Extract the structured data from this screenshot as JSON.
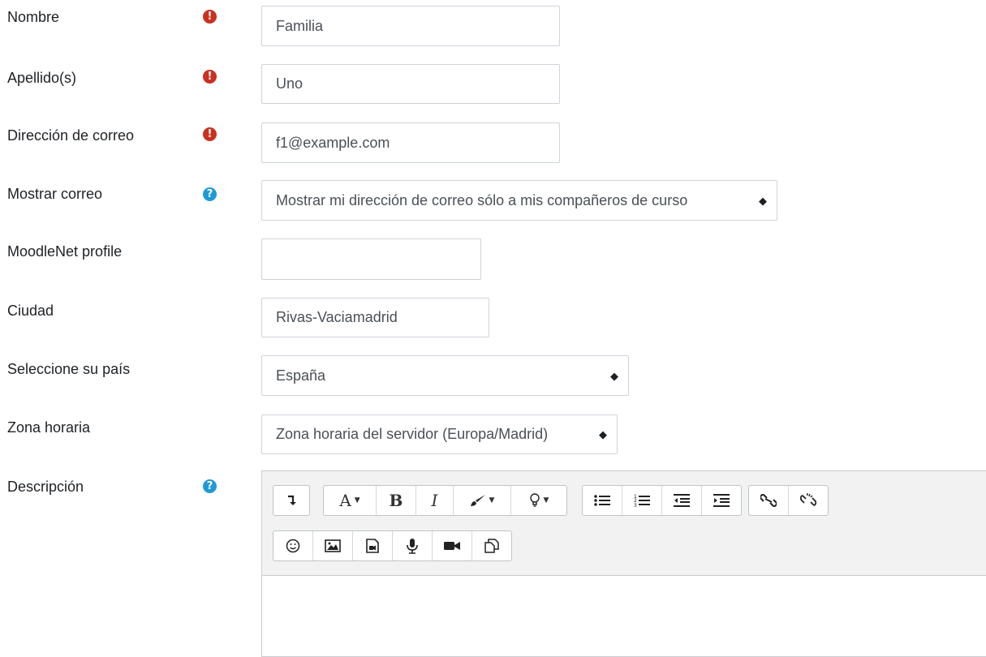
{
  "form": {
    "fields": [
      {
        "label": "Nombre",
        "indicator": "required",
        "value": "Familia"
      },
      {
        "label": "Apellido(s)",
        "indicator": "required",
        "value": "Uno"
      },
      {
        "label": "Dirección de correo",
        "indicator": "required",
        "value": "f1@example.com"
      },
      {
        "label": "Mostrar correo",
        "indicator": "help",
        "value": "Mostrar mi dirección de correo sólo a mis compañeros de curso"
      },
      {
        "label": "MoodleNet profile",
        "indicator": "none",
        "value": ""
      },
      {
        "label": "Ciudad",
        "indicator": "none",
        "value": "Rivas-Vaciamadrid"
      },
      {
        "label": "Seleccione su país",
        "indicator": "none",
        "value": "España"
      },
      {
        "label": "Zona horaria",
        "indicator": "none",
        "value": "Zona horaria del servidor (Europa/Madrid)"
      },
      {
        "label": "Descripción",
        "indicator": "help",
        "value": ""
      }
    ]
  },
  "indicators": {
    "required_icon": "exclamation-icon",
    "help_icon": "question-icon",
    "required_color": "#ca3120",
    "help_color": "#1f9ad6"
  },
  "editor": {
    "toolbar_row1": [
      "show-more-icon",
      "font-family-icon",
      "bold-icon",
      "italic-icon",
      "brush-icon",
      "lightbulb-icon",
      "unordered-list-icon",
      "ordered-list-icon",
      "outdent-icon",
      "indent-icon",
      "link-icon",
      "unlink-icon"
    ],
    "toolbar_row2": [
      "emoji-icon",
      "image-icon",
      "media-icon",
      "microphone-icon",
      "video-icon",
      "manage-files-icon"
    ],
    "bold_glyph": "B",
    "italic_glyph": "I",
    "font_glyph": "A"
  }
}
